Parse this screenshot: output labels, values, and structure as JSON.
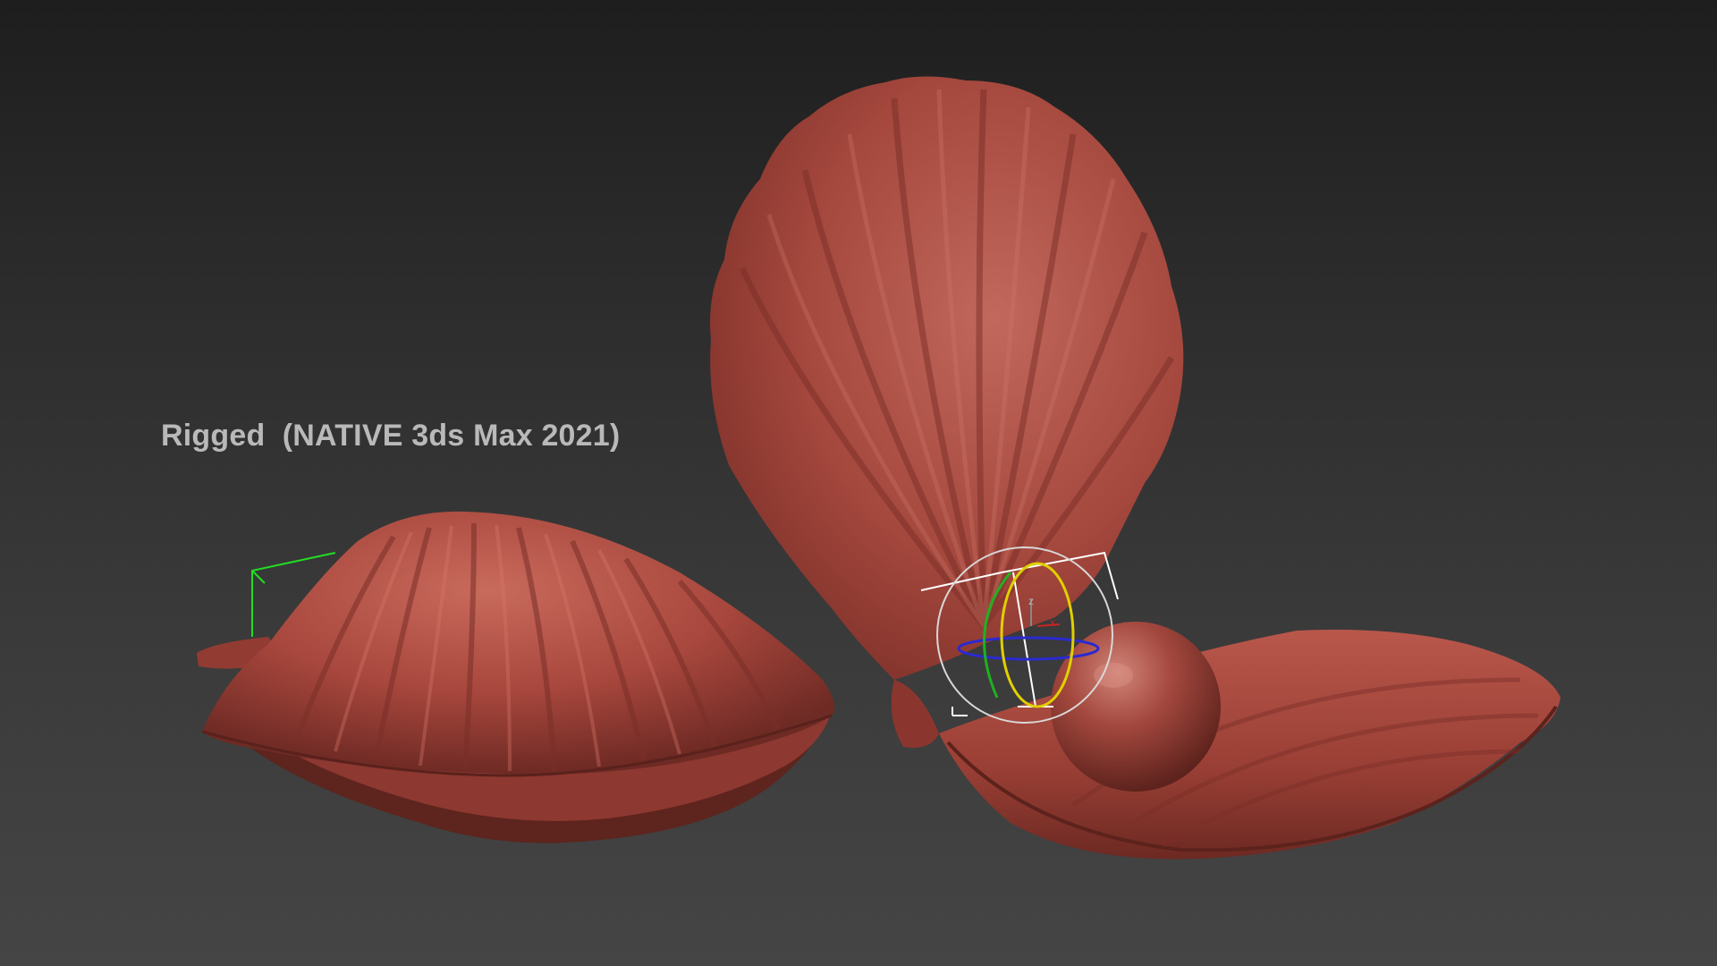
{
  "viewport": {
    "caption": "Rigged  (NATIVE 3ds Max 2021)",
    "background_top": "#1e1e1e",
    "background_bottom": "#454545"
  },
  "scene": {
    "objects": [
      "closed-shell",
      "open-shell-top",
      "open-shell-bottom",
      "pearl"
    ],
    "shell_color": "#a8473d",
    "shell_highlight": "#c8665a",
    "shell_shadow": "#6e2a24"
  },
  "gizmo": {
    "axis_label_z": "z",
    "axis_label_x": "x",
    "ring_colors": {
      "outer": "#d8d8d8",
      "z_ring": "#2a2ad0",
      "x_ring": "#e0d000",
      "y_ring": "#20b020",
      "x_axis": "#cc2222"
    },
    "bounding_box_color": "#ffffff",
    "selection_box_color": "#22dd22"
  }
}
